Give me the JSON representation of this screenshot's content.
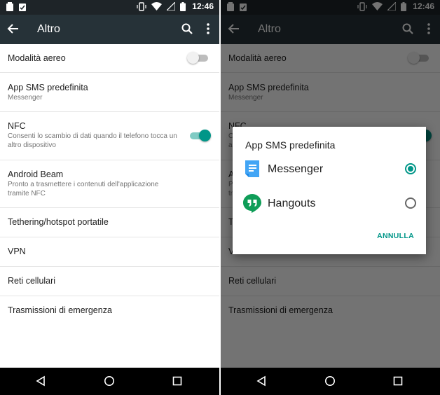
{
  "status_bar": {
    "time": "12:46",
    "left_icons": [
      "notification-icon",
      "clipboard-icon"
    ],
    "right_icons": [
      "vibrate-icon",
      "wifi-icon",
      "signal-icon",
      "battery-icon"
    ]
  },
  "app_bar": {
    "title": "Altro",
    "back_icon": "arrow-back-icon",
    "actions": [
      "search-icon",
      "more-vert-icon"
    ]
  },
  "settings": {
    "airplane": {
      "title": "Modalità aereo",
      "enabled": false
    },
    "sms": {
      "title": "App SMS predefinita",
      "subtitle": "Messenger"
    },
    "nfc": {
      "title": "NFC",
      "subtitle": "Consenti lo scambio di dati quando il telefono tocca un altro dispositivo",
      "enabled": true
    },
    "beam": {
      "title": "Android Beam",
      "subtitle": "Pronto a trasmettere i contenuti dell'applicazione tramite NFC"
    },
    "tethering": {
      "title": "Tethering/hotspot portatile"
    },
    "vpn": {
      "title": "VPN"
    },
    "cellular": {
      "title": "Reti cellulari"
    },
    "emergency": {
      "title": "Trasmissioni di emergenza"
    }
  },
  "dialog": {
    "title": "App SMS predefinita",
    "options": [
      {
        "label": "Messenger",
        "selected": true,
        "icon": "messenger-app-icon"
      },
      {
        "label": "Hangouts",
        "selected": false,
        "icon": "hangouts-app-icon"
      }
    ],
    "cancel_label": "ANNULLA"
  },
  "colors": {
    "accent": "#009688",
    "app_bar": "#263238",
    "status_bar": "#1e2428",
    "messenger_icon": "#42a5f5",
    "hangouts_icon": "#0f9d58"
  }
}
